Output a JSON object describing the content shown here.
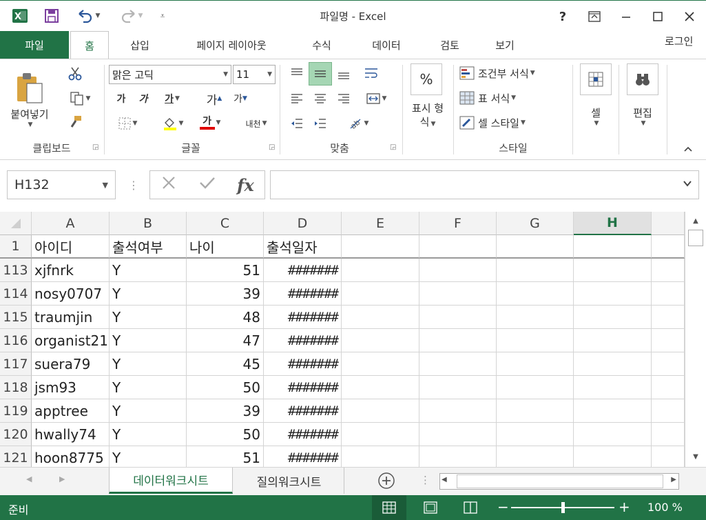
{
  "title_bar": {
    "title": "파일명 - Excel",
    "help": "?"
  },
  "tabs": [
    "파일",
    "홈",
    "삽입",
    "페이지 레이아웃",
    "수식",
    "데이터",
    "검토",
    "보기"
  ],
  "login": "로그인",
  "ribbon": {
    "clipboard": {
      "paste_label": "붙여넣기",
      "group_label": "클립보드"
    },
    "font": {
      "font_name": "맑은 고딕",
      "font_size": "11",
      "bold": "가",
      "italic": "가",
      "underline": "가",
      "grow": "가",
      "shrink": "가",
      "color_sample": "가",
      "phonetic": "내천",
      "group_label": "글꼴"
    },
    "alignment": {
      "group_label": "맞춤"
    },
    "number": {
      "label_line1": "표시 형",
      "label_line2": "식",
      "symbol": "%"
    },
    "styles": {
      "conditional": "조건부 서식",
      "table": "표 서식",
      "cell_style": "셀 스타일",
      "group_label": "스타일"
    },
    "cells": {
      "label": "셀"
    },
    "editing": {
      "label": "편집"
    }
  },
  "formula_bar": {
    "name_box": "H132",
    "fx": "fx",
    "value": ""
  },
  "sheet": {
    "columns": [
      "A",
      "B",
      "C",
      "D",
      "E",
      "F",
      "G",
      "H"
    ],
    "selected_column": "H",
    "header_row": {
      "row": "1",
      "cells": [
        "아이디",
        "출석여부",
        "나이",
        "출석일자"
      ]
    },
    "rows": [
      {
        "row": "113",
        "id": "xjfnrk",
        "attend": "Y",
        "age": "51",
        "date": "#######"
      },
      {
        "row": "114",
        "id": "nosy0707",
        "attend": "Y",
        "age": "39",
        "date": "#######"
      },
      {
        "row": "115",
        "id": "traumjin",
        "attend": "Y",
        "age": "48",
        "date": "#######"
      },
      {
        "row": "116",
        "id": "organist21",
        "attend": "Y",
        "age": "47",
        "date": "#######"
      },
      {
        "row": "117",
        "id": "suera79",
        "attend": "Y",
        "age": "45",
        "date": "#######"
      },
      {
        "row": "118",
        "id": "jsm93",
        "attend": "Y",
        "age": "50",
        "date": "#######"
      },
      {
        "row": "119",
        "id": "apptree",
        "attend": "Y",
        "age": "39",
        "date": "#######"
      },
      {
        "row": "120",
        "id": "hwally74",
        "attend": "Y",
        "age": "50",
        "date": "#######"
      },
      {
        "row": "121",
        "id": "hoon8775",
        "attend": "Y",
        "age": "51",
        "date": "#######"
      }
    ]
  },
  "sheet_tabs": [
    "데이터워크시트",
    "질의워크시트"
  ],
  "status_bar": {
    "ready": "준비",
    "zoom": "100 %"
  },
  "colors": {
    "excel_green": "#217346",
    "header_bg": "#f3f3f3",
    "grid_line": "#d4d4d4"
  }
}
